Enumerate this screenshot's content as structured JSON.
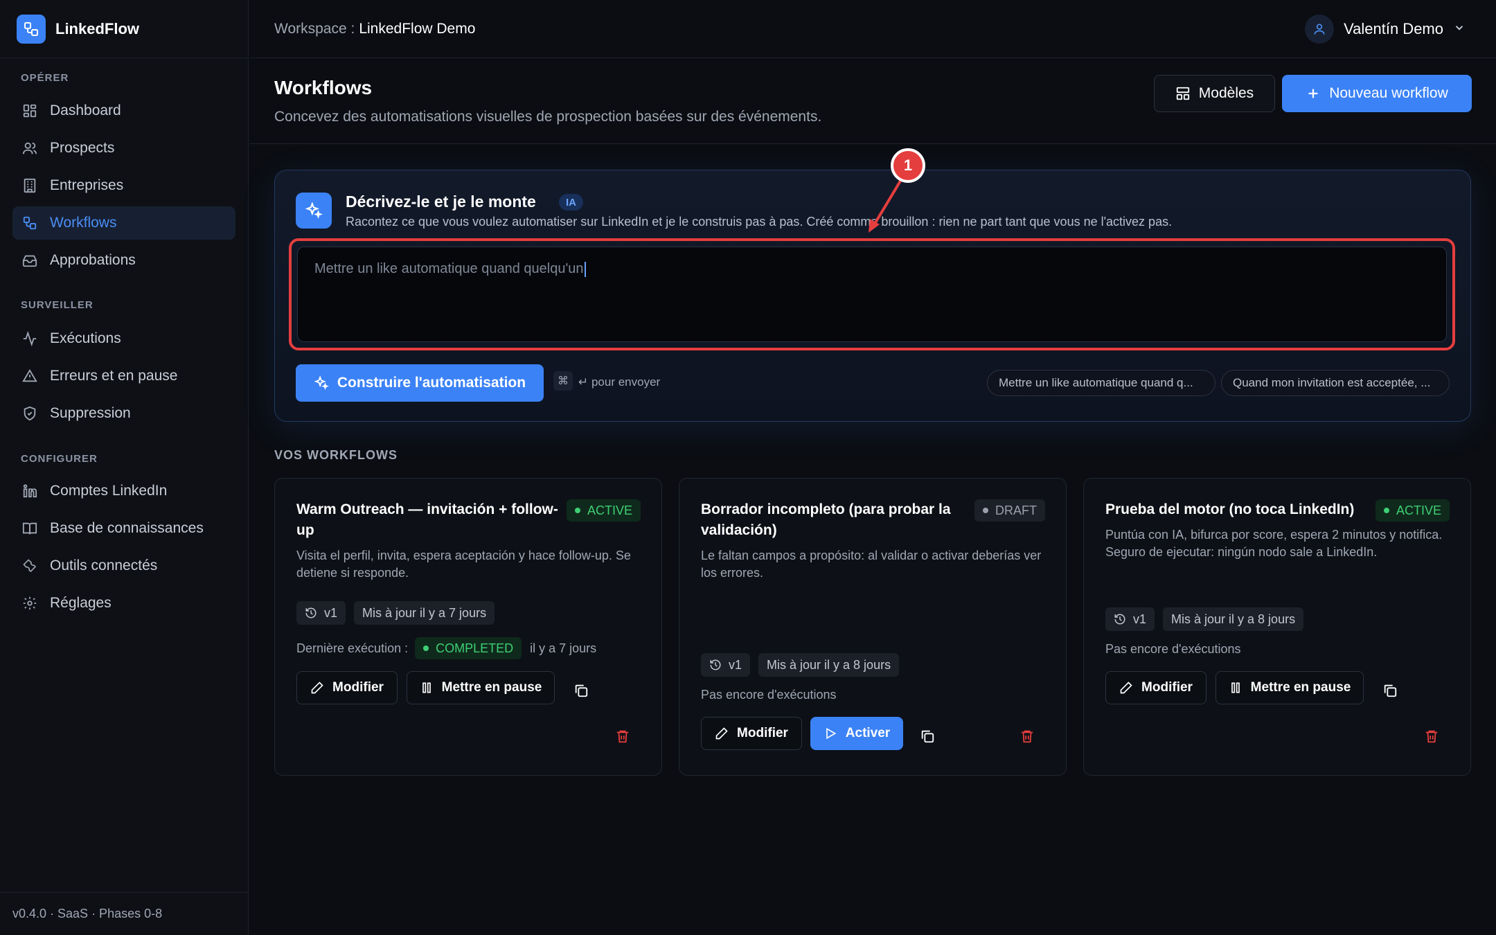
{
  "brand": {
    "name": "LinkedFlow",
    "icon": "workflow-icon"
  },
  "sidebar": {
    "sections": [
      {
        "title": "OPÉRER"
      },
      {
        "title": "SURVEILLER"
      },
      {
        "title": "CONFIGURER"
      }
    ],
    "items": [
      {
        "label": "Dashboard",
        "icon": "dashboard-icon"
      },
      {
        "label": "Prospects",
        "icon": "users-icon"
      },
      {
        "label": "Entreprises",
        "icon": "building-icon"
      },
      {
        "label": "Workflows",
        "icon": "workflow-icon",
        "active": true
      },
      {
        "label": "Approbations",
        "icon": "inbox-icon"
      },
      {
        "label": "Exécutions",
        "icon": "activity-icon"
      },
      {
        "label": "Erreurs et en pause",
        "icon": "warning-icon"
      },
      {
        "label": "Suppression",
        "icon": "shield-icon"
      },
      {
        "label": "Comptes LinkedIn",
        "icon": "linkedin-icon"
      },
      {
        "label": "Base de connaissances",
        "icon": "book-icon"
      },
      {
        "label": "Outils connectés",
        "icon": "wrench-icon"
      },
      {
        "label": "Réglages",
        "icon": "gear-icon"
      }
    ],
    "footer": "v0.4.0 · SaaS · Phases 0-8"
  },
  "topbar": {
    "workspace_label": "Workspace :",
    "workspace_name": "LinkedFlow Demo",
    "user_name": "Valentín Demo"
  },
  "header": {
    "title": "Workflows",
    "subtitle": "Concevez des automatisations visuelles de prospection basées sur des événements.",
    "models_label": "Modèles",
    "new_label": "Nouveau workflow"
  },
  "ai": {
    "title": "Décrivez-le et je le monte",
    "badge": "IA",
    "description": "Racontez ce que vous voulez automatiser sur LinkedIn et je le construis pas à pas. Créé comme brouillon : rien ne part tant que vous ne l'activez pas.",
    "input_value": "Mettre un like automatique quand quelqu'un",
    "build_label": "Construire l'automatisation",
    "kbd": "⌘",
    "send_hint": "↵ pour envoyer",
    "suggestions": [
      "Mettre un like automatique quand q...",
      "Quand mon invitation est acceptée, ..."
    ],
    "annotation": "1"
  },
  "workflows": {
    "section_title": "VOS WORKFLOWS",
    "cards": [
      {
        "title": "Warm Outreach — invitación + follow-up",
        "status": "ACTIVE",
        "description": "Visita el perfil, invita, espera aceptación y hace follow-up. Se detiene si responde.",
        "version": "v1",
        "updated": "Mis à jour il y a 7 jours",
        "last_run_label": "Dernière exécution :",
        "last_run_status": "COMPLETED",
        "last_run_time": "il y a 7 jours",
        "edit_label": "Modifier",
        "action_label": "Mettre en pause"
      },
      {
        "title": "Borrador incompleto (para probar la validación)",
        "status": "DRAFT",
        "description": "Le faltan campos a propósito: al validar o activar deberías ver los errores.",
        "version": "v1",
        "updated": "Mis à jour il y a 8 jours",
        "no_runs": "Pas encore d'exécutions",
        "edit_label": "Modifier",
        "action_label": "Activer"
      },
      {
        "title": "Prueba del motor (no toca LinkedIn)",
        "status": "ACTIVE",
        "description": "Puntúa con IA, bifurca por score, espera 2 minutos y notifica. Seguro de ejecutar: ningún nodo sale a LinkedIn.",
        "version": "v1",
        "updated": "Mis à jour il y a 8 jours",
        "no_runs": "Pas encore d'exécutions",
        "edit_label": "Modifier",
        "action_label": "Mettre en pause"
      }
    ]
  },
  "colors": {
    "accent": "#3b82f6",
    "success": "#3ecf74",
    "danger": "#e53e3e"
  }
}
